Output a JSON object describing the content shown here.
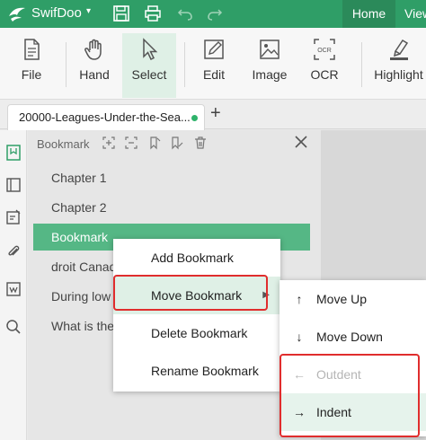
{
  "titlebar": {
    "app_name": "SwifDoo",
    "app_menu_caret": "▾",
    "tabs": [
      "Home",
      "View"
    ],
    "accent": "#2f9e67"
  },
  "ribbon": {
    "buttons": [
      "File",
      "Hand",
      "Select",
      "Edit",
      "Image",
      "OCR",
      "Highlight"
    ],
    "ocr_icon_text": "OCR"
  },
  "doc_tab": {
    "title": "20000-Leagues-Under-the-Sea...",
    "add": "+"
  },
  "panel": {
    "title": "Bookmark",
    "close": "×",
    "items": [
      "Chapter 1",
      "Chapter 2",
      "Bookmark",
      "droit Canad",
      "During low",
      "What is the"
    ],
    "selected_index": 2
  },
  "context_menu": {
    "items": [
      "Add Bookmark",
      "Move Bookmark",
      "Delete Bookmark",
      "Rename Bookmark"
    ],
    "submenu_arrow": "▶"
  },
  "submenu": {
    "items": [
      {
        "icon": "↑",
        "label": "Move Up"
      },
      {
        "icon": "↓",
        "label": "Move Down"
      },
      {
        "icon": "←",
        "label": "Outdent"
      },
      {
        "icon": "→",
        "label": "Indent"
      }
    ]
  },
  "colors": {
    "selection": "#55b785",
    "highlight_box": "#e02d2d",
    "menu_hover": "#dff0e6"
  }
}
